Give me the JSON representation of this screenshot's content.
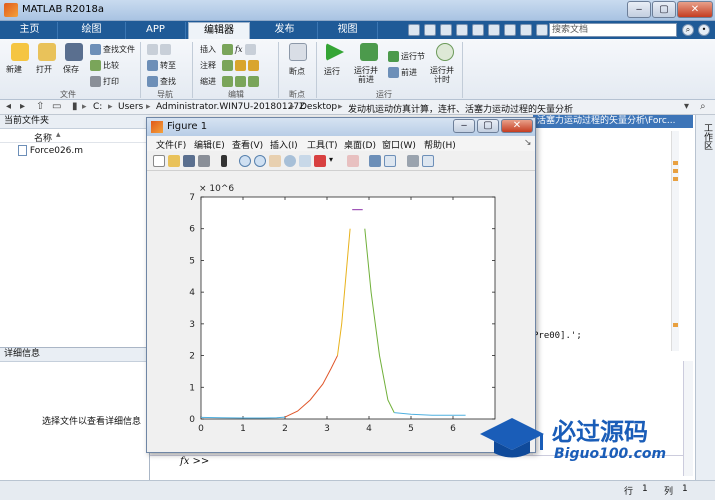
{
  "window": {
    "title": "MATLAB R2018a"
  },
  "ribbon_tabs": [
    "主页",
    "绘图",
    "APP",
    "编辑器",
    "发布",
    "视图"
  ],
  "active_tab": "编辑器",
  "search": {
    "placeholder": "搜索文档"
  },
  "ribbon": {
    "file": {
      "new": "新建",
      "open": "打开",
      "save": "保存",
      "find_file": "查找文件",
      "compare": "比较",
      "print": "打印",
      "group": "文件"
    },
    "nav": {
      "goto": "转至",
      "find": "查找",
      "group": "导航"
    },
    "edit": {
      "insert": "插入",
      "comment": "注释",
      "indent": "缩进",
      "fx": "fx",
      "group": "编辑"
    },
    "breakpoints": {
      "label": "断点",
      "group": "断点"
    },
    "run": {
      "run": "运行",
      "run_advance": "运行并\n前进",
      "run_section": "运行节",
      "advance": "前进",
      "run_time": "运行并\n计时",
      "group": "运行"
    }
  },
  "address": {
    "segments": [
      "C:",
      "Users",
      "Administrator.WIN7U-20180127Z",
      "Desktop",
      "发动机运动仿真计算，连杆、活塞力运动过程的矢量分析"
    ]
  },
  "file_panel": {
    "title": "当前文件夹",
    "column": "名称",
    "files": [
      "Force026.m"
    ]
  },
  "detail_panel": {
    "title": "详细信息",
    "hint": "选择文件以查看详细信息"
  },
  "right_panel": {
    "header": "活塞力运动过程的矢量分析\\Forc...",
    "code_snippet": "Pre00].';",
    "strip_label": "工作区"
  },
  "command": {
    "prompt": "fx >>"
  },
  "status": {
    "row_label": "行",
    "row": "1",
    "col_label": "列",
    "col": "1"
  },
  "figure": {
    "title": "Figure 1",
    "menu": [
      "文件(F)",
      "编辑(E)",
      "查看(V)",
      "插入(I)",
      "工具(T)",
      "桌面(D)",
      "窗口(W)",
      "帮助(H)"
    ]
  },
  "chart_data": {
    "type": "line",
    "title": "",
    "xlabel": "",
    "ylabel": "",
    "y_exponent": "× 10^6",
    "xlim": [
      0,
      7
    ],
    "ylim": [
      0,
      7
    ],
    "x_ticks": [
      0,
      1,
      2,
      3,
      4,
      5,
      6
    ],
    "y_ticks": [
      0,
      1,
      2,
      3,
      4,
      5,
      6,
      7
    ],
    "series": [
      {
        "color": "#4fb0e0",
        "x": [
          0,
          0.5,
          1.0,
          1.5,
          1.8,
          2.0
        ],
        "y": [
          0.05,
          0.04,
          0.03,
          0.03,
          0.04,
          0.06
        ]
      },
      {
        "color": "#e0562a",
        "x": [
          2.0,
          2.3,
          2.6,
          2.9,
          3.1,
          3.25
        ],
        "y": [
          0.06,
          0.25,
          0.6,
          1.1,
          1.6,
          2.0
        ]
      },
      {
        "color": "#e8b21c",
        "x": [
          3.25,
          3.35,
          3.45,
          3.55
        ],
        "y": [
          2.0,
          3.0,
          4.5,
          6.0
        ]
      },
      {
        "color": "#8b2fa8",
        "x": [
          3.6,
          3.85
        ],
        "y": [
          6.6,
          6.6
        ]
      },
      {
        "color": "#70b03a",
        "x": [
          3.9,
          4.05,
          4.25,
          4.45,
          4.6
        ],
        "y": [
          6.0,
          4.0,
          2.0,
          0.6,
          0.2
        ]
      },
      {
        "color": "#4fb0e0",
        "x": [
          4.6,
          5.0,
          5.5,
          6.0,
          6.3
        ],
        "y": [
          0.2,
          0.15,
          0.12,
          0.12,
          0.12
        ]
      }
    ]
  }
}
